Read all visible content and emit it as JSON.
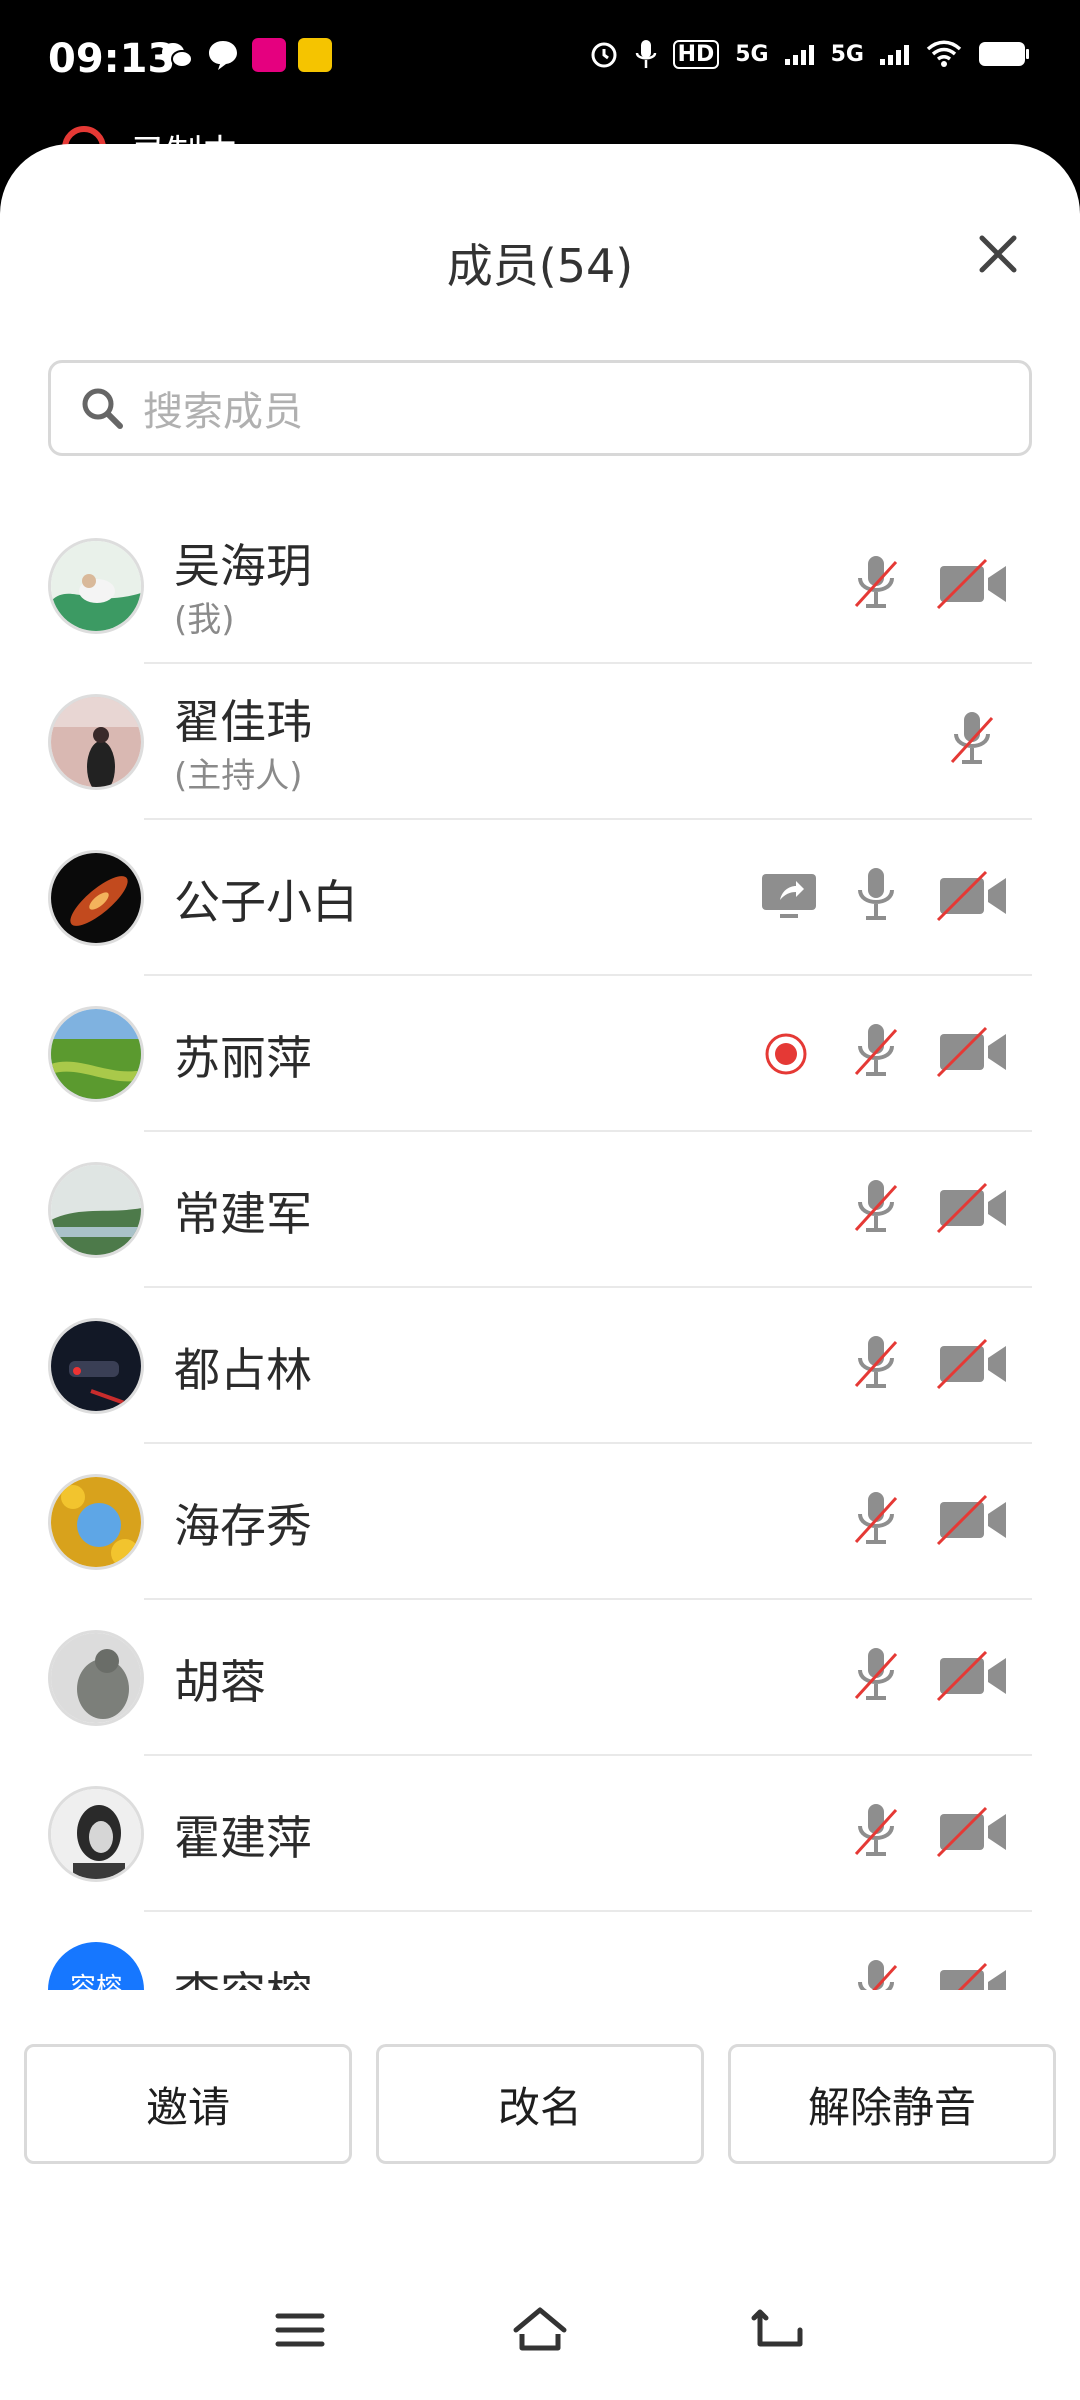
{
  "status_bar": {
    "time": "09:13",
    "network_1": "5G",
    "network_2": "5G",
    "hd_label": "HD"
  },
  "recording_strip": {
    "label": "录制中"
  },
  "sheet": {
    "title": "成员(54)",
    "search_placeholder": "搜索成员"
  },
  "members": [
    {
      "name": "吴海玥",
      "role": "(我)",
      "avatar": "landscape-illustration"
    },
    {
      "name": "翟佳玮",
      "role": "(主持人)",
      "avatar": "person-photo"
    },
    {
      "name": "公子小白",
      "role": "",
      "avatar": "galaxy-photo"
    },
    {
      "name": "苏丽萍",
      "role": "",
      "avatar": "green-field-photo"
    },
    {
      "name": "常建军",
      "role": "",
      "avatar": "lake-photo"
    },
    {
      "name": "都占林",
      "role": "",
      "avatar": "night-car-photo"
    },
    {
      "name": "海存秀",
      "role": "",
      "avatar": "autumn-leaves-photo"
    },
    {
      "name": "胡蓉",
      "role": "",
      "avatar": "statue-photo"
    },
    {
      "name": "霍建萍",
      "role": "",
      "avatar": "portrait-bw-photo"
    },
    {
      "name": "李容榕",
      "role": "",
      "avatar_text": "容榕"
    }
  ],
  "actions": {
    "invite": "邀请",
    "rename": "改名",
    "unmute": "解除静音"
  },
  "colors": {
    "accent_red": "#e53935",
    "icon_gray": "#8e8e8e",
    "avatar_blue": "#1677ff"
  }
}
